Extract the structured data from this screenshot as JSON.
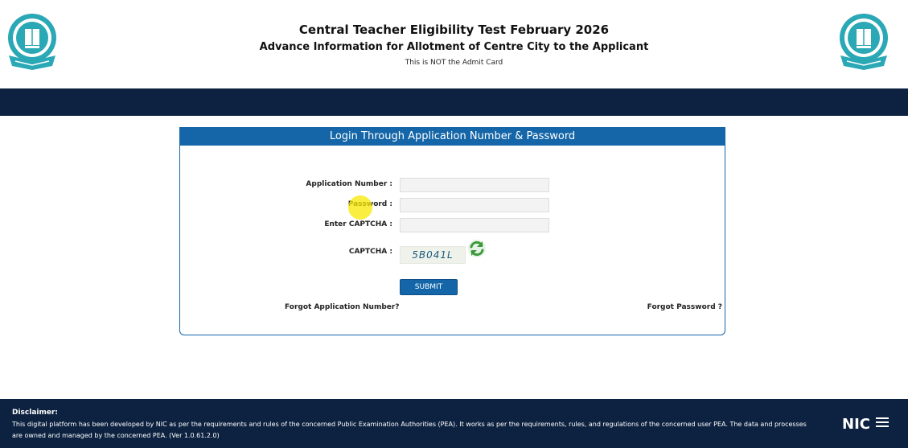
{
  "header": {
    "title": "Central Teacher Eligibility Test February 2026",
    "subtitle": "Advance Information for Allotment of Centre City to the Applicant",
    "note": "This is NOT the Admit Card"
  },
  "login": {
    "heading": "Login Through Application Number & Password",
    "application_label": "Application Number :",
    "application_value": "",
    "password_label": "Password :",
    "password_value": "",
    "captcha_entry_label": "Enter CAPTCHA :",
    "captcha_entry_value": "",
    "captcha_label": "CAPTCHA :",
    "captcha_code": "5B041L",
    "submit_label": "SUBMIT",
    "forgot_application": "Forgot Application Number?",
    "forgot_password": "Forgot Password ?"
  },
  "footer": {
    "disclaimer_title": "Disclaimer:",
    "disclaimer_text": "This digital platform has been developed by NIC as per the requirements and rules of the concerned Public Examination Authorities (PEA). It works as per the requirements, rules, and regulations of the concerned user PEA. The data and processes are owned and managed by the concerned PEA. (Ver 1.0.61.2.0)",
    "nic_logo_text": "NIC"
  },
  "colors": {
    "navy": "#0d2240",
    "primary_blue": "#1466a8",
    "logo_teal": "#2aa8b5",
    "refresh_green": "#3a9a3a",
    "cursor_highlight": "#f8e800"
  },
  "icons": {
    "left_logo": "cbse-emblem-icon",
    "right_logo": "cbse-emblem-icon",
    "captcha_refresh": "refresh-icon",
    "nic_logo": "nic-logo-icon"
  }
}
